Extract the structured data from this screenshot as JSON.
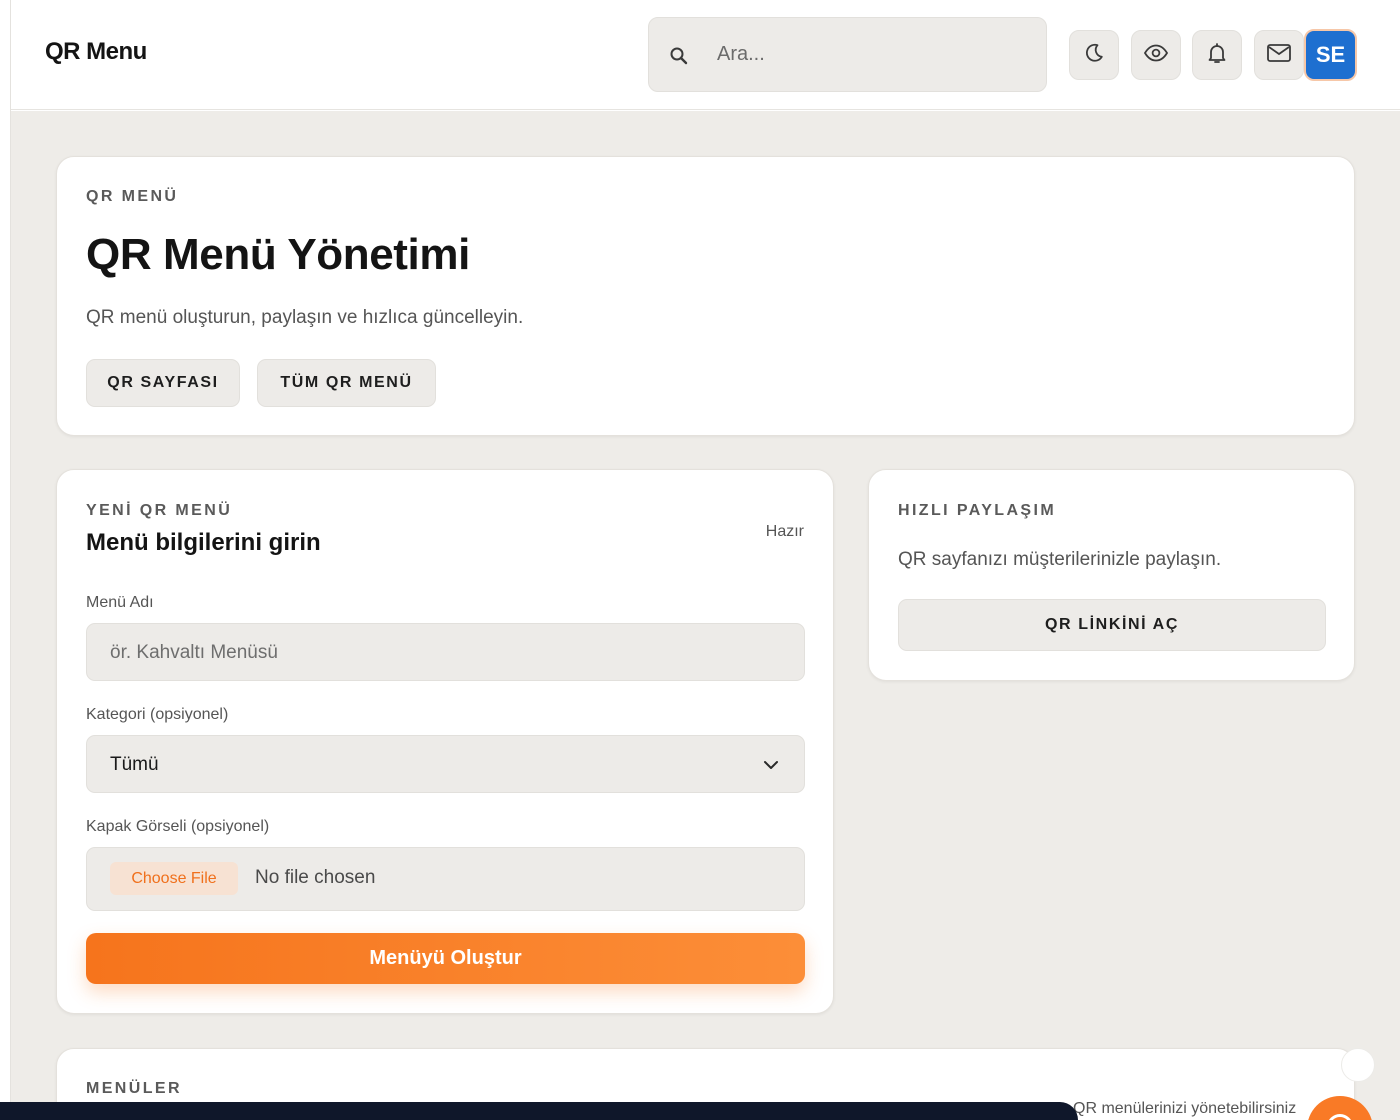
{
  "header": {
    "brand": "QR Menu",
    "search_placeholder": "Ara...",
    "avatar_initials": "SE",
    "icons": [
      "moon-icon",
      "eye-icon",
      "bell-icon",
      "mail-icon",
      "search-icon"
    ]
  },
  "hero": {
    "eyebrow": "QR MENÜ",
    "title": "QR Menü Yönetimi",
    "subtitle": "QR menü oluşturun, paylaşın ve hızlıca güncelleyin.",
    "btn_qr_page": "QR SAYFASI",
    "btn_all_menus": "TÜM QR MENÜ"
  },
  "new_menu": {
    "eyebrow": "YENİ QR MENÜ",
    "title": "Menü bilgilerini girin",
    "status": "Hazır",
    "name_label": "Menü Adı",
    "name_placeholder": "ör. Kahvaltı Menüsü",
    "category_label": "Kategori (opsiyonel)",
    "category_value": "Tümü",
    "cover_label": "Kapak Görseli (opsiyonel)",
    "choose_file": "Choose File",
    "no_file": "No file chosen",
    "submit": "Menüyü Oluştur"
  },
  "quick_share": {
    "eyebrow": "HIZLI PAYLAŞIM",
    "text": "QR sayfanızı müşterilerinizle paylaşın.",
    "button": "QR LİNKİNİ AÇ"
  },
  "menus": {
    "eyebrow": "MENÜLER",
    "partial_text": "QR menülerinizi yönetebilirsiniz"
  },
  "colors": {
    "accent": "#f97a26",
    "avatar": "#1e6fd0",
    "page_bg": "#eeece8",
    "field_bg": "#edebe8"
  }
}
